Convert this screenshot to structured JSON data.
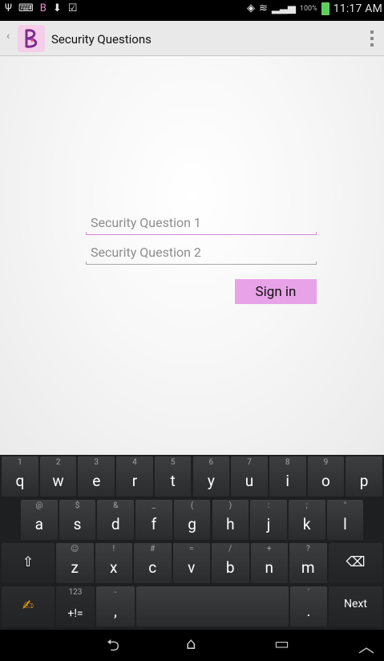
{
  "status_bar": {
    "left_icons": [
      "usb-icon",
      "keyboard-icon",
      "app-b-icon",
      "download-icon",
      "check-icon"
    ],
    "battery_percent": "100%",
    "time": "11:17 AM"
  },
  "action_bar": {
    "title": "Security Questions"
  },
  "form": {
    "question1_placeholder": "Security Question 1",
    "question2_placeholder": "Security Question 2",
    "sign_in_label": "Sign in"
  },
  "keyboard": {
    "row1": [
      {
        "main": "q",
        "hint": "1"
      },
      {
        "main": "w",
        "hint": "2"
      },
      {
        "main": "e",
        "hint": "3"
      },
      {
        "main": "r",
        "hint": "4"
      },
      {
        "main": "t",
        "hint": "5"
      },
      {
        "main": "y",
        "hint": "6"
      },
      {
        "main": "u",
        "hint": "7"
      },
      {
        "main": "i",
        "hint": "8"
      },
      {
        "main": "o",
        "hint": "9"
      },
      {
        "main": "p",
        "hint": ""
      }
    ],
    "row2": [
      {
        "main": "a",
        "hint": "@"
      },
      {
        "main": "s",
        "hint": "$"
      },
      {
        "main": "d",
        "hint": "&"
      },
      {
        "main": "f",
        "hint": "_"
      },
      {
        "main": "g",
        "hint": "("
      },
      {
        "main": "h",
        "hint": ")"
      },
      {
        "main": "j",
        "hint": ":"
      },
      {
        "main": "k",
        "hint": ";"
      },
      {
        "main": "l",
        "hint": "\""
      }
    ],
    "row3": [
      {
        "main": "z",
        "hint": "☺"
      },
      {
        "main": "x",
        "hint": "!"
      },
      {
        "main": "c",
        "hint": "#"
      },
      {
        "main": "v",
        "hint": "="
      },
      {
        "main": "b",
        "hint": "/"
      },
      {
        "main": "n",
        "hint": "+"
      },
      {
        "main": "m",
        "hint": "?"
      }
    ],
    "symbols_hint": "123",
    "symbols_label": "+!=",
    "comma": ",",
    "comma_hint": "-",
    "period": ".",
    "period_hint": "'",
    "next_label": "Next"
  }
}
